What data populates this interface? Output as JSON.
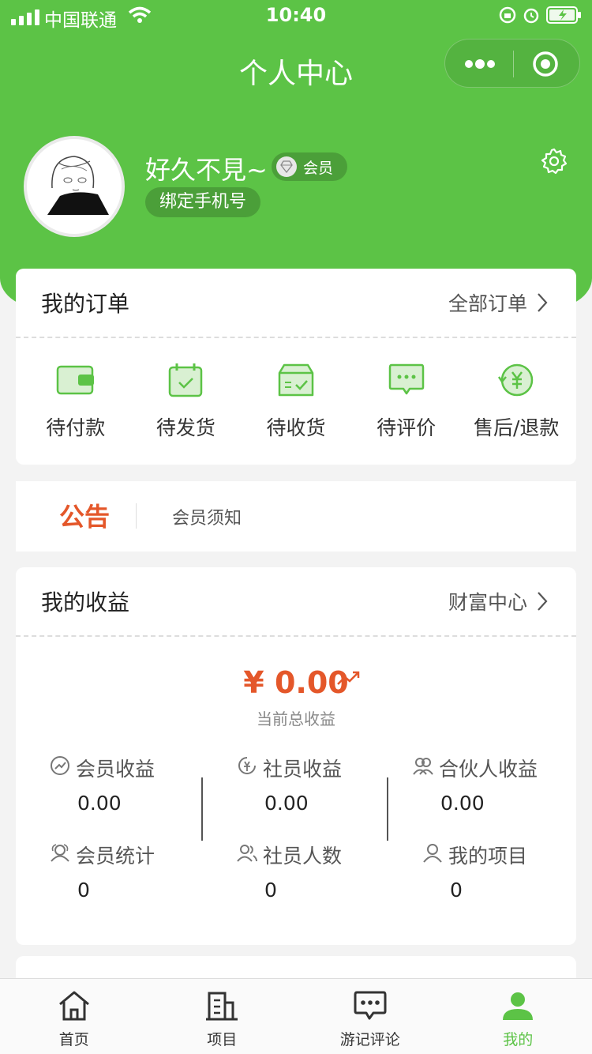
{
  "status_bar": {
    "carrier": "中国联通",
    "time": "10:40"
  },
  "nav": {
    "title": "个人中心"
  },
  "profile": {
    "username": "好久不見~",
    "badge_label": "会员",
    "bind_phone_label": "绑定手机号"
  },
  "orders": {
    "title": "我的订单",
    "more_label": "全部订单",
    "items": [
      {
        "label": "待付款",
        "icon": "wallet-icon"
      },
      {
        "label": "待发货",
        "icon": "calendar-check-icon"
      },
      {
        "label": "待收货",
        "icon": "box-icon"
      },
      {
        "label": "待评价",
        "icon": "comment-icon"
      },
      {
        "label": "售后/退款",
        "icon": "refund-icon"
      }
    ]
  },
  "notice": {
    "tag": "公告",
    "text": "会员须知"
  },
  "earnings": {
    "title": "我的收益",
    "more_label": "财富中心",
    "total_amount": "¥ 0.00",
    "total_label": "当前总收益",
    "stats": [
      {
        "label": "会员收益",
        "value": "0.00",
        "icon": "earnings-icon"
      },
      {
        "label": "社员收益",
        "value": "0.00",
        "icon": "yuan-refresh-icon"
      },
      {
        "label": "合伙人收益",
        "value": "0.00",
        "icon": "partners-icon"
      },
      {
        "label": "会员统计",
        "value": "0",
        "icon": "member-stat-icon"
      },
      {
        "label": "社员人数",
        "value": "0",
        "icon": "users-icon"
      },
      {
        "label": "我的项目",
        "value": "0",
        "icon": "user-icon"
      }
    ]
  },
  "tabbar": {
    "items": [
      {
        "label": "首页",
        "icon": "home-icon"
      },
      {
        "label": "项目",
        "icon": "building-icon"
      },
      {
        "label": "游记评论",
        "icon": "chat-icon"
      },
      {
        "label": "我的",
        "icon": "profile-icon"
      }
    ],
    "active_index": 3,
    "active_color": "#5cc346"
  },
  "colors": {
    "brand": "#5cc346",
    "accent": "#e4572a"
  }
}
